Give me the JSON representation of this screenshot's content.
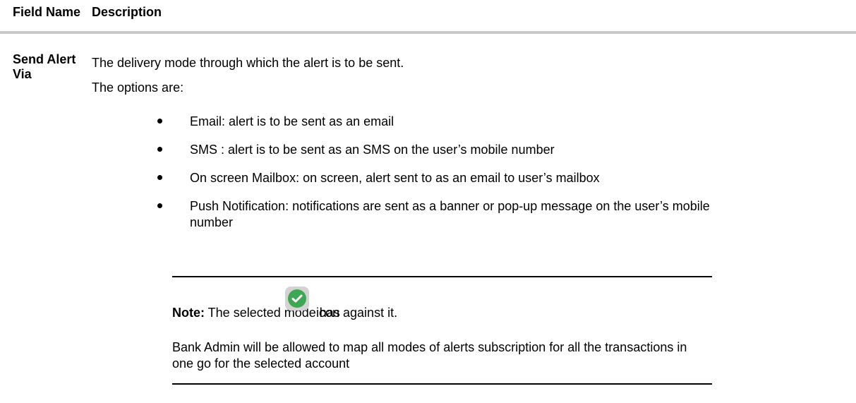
{
  "table": {
    "header": {
      "field_name": "Field Name",
      "description": "Description"
    },
    "row": {
      "field_name": "Send Alert Via",
      "intro": "The delivery mode through which the alert is to be sent.",
      "options_label": "The options are:",
      "options": [
        "Email: alert is to be sent as an email",
        "SMS : alert is to be sent as an SMS on the user’s mobile number",
        "On screen Mailbox: on screen, alert sent to as an email to user’s mailbox",
        "Push Notification: notifications are sent as a banner or pop-up message on the user’s mobile number"
      ],
      "note": {
        "label": "Note:",
        "text_before_icon": " The selected mode has",
        "icon": "green-check-circle-icon",
        "text_after_icon": "icon against it.",
        "admin_text": "Bank Admin will be allowed to map all modes of alerts subscription for all the transactions in one go for the selected account"
      }
    }
  },
  "colors": {
    "header_rule": "#c8c8c8",
    "check_icon_green": "#3fa653",
    "check_icon_bg": "#d3d3d3"
  }
}
